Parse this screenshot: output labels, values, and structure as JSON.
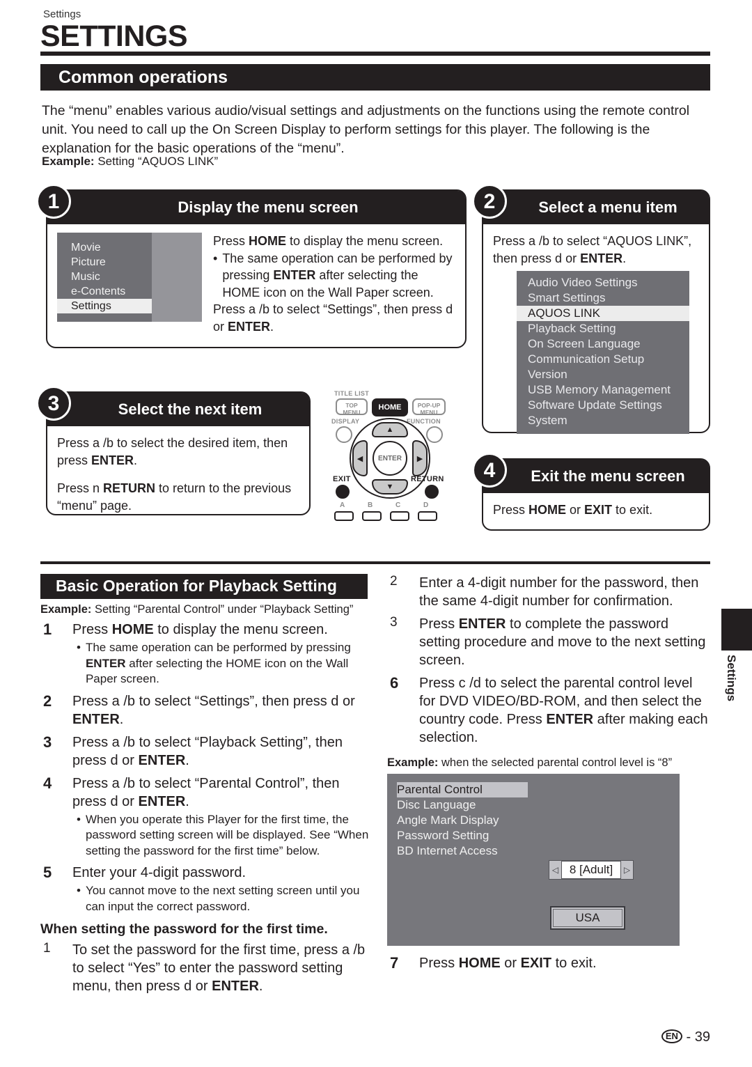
{
  "header": {
    "running_head": "Settings",
    "title": "SETTINGS",
    "section_title": "Common operations"
  },
  "intro": {
    "paragraph": "The “menu” enables various audio/visual settings and adjustments on the functions using the remote control unit. You need to call up the On Screen Display to perform settings for this player. The following is the explanation for the basic operations of the “menu”.",
    "example_label": "Example:",
    "example_text": "Setting “AQUOS LINK”"
  },
  "steps": {
    "one": {
      "number": "1",
      "title": "Display the menu screen",
      "line1_a": "Press ",
      "line1_b": "HOME",
      "line1_c": " to display the menu screen.",
      "bullet_dot": "•",
      "bullet_a": "The same operation can be performed by pressing ",
      "bullet_b": "ENTER",
      "bullet_c": " after selecting the HOME icon on the Wall Paper screen.",
      "line2_a": "Press a /b  to select “Settings”, then press d  or ",
      "line2_b": "ENTER",
      "line2_c": ".",
      "menu_items": [
        "Movie",
        "Picture",
        "Music",
        "e-Contents",
        "Settings"
      ],
      "menu_selected": "Settings"
    },
    "two": {
      "number": "2",
      "title": "Select a menu item",
      "line_a": "Press a /b  to select “AQUOS LINK”, then press d  or ",
      "line_b": "ENTER",
      "line_c": ".",
      "menu_items": [
        "Audio Video Settings",
        "Smart Settings",
        "AQUOS LINK",
        "Playback Setting",
        "On Screen Language",
        "Communication Setup",
        "Version",
        "USB Memory Management",
        "Software Update Settings",
        "System"
      ],
      "menu_selected": "AQUOS LINK"
    },
    "three": {
      "number": "3",
      "title": "Select the next item",
      "p1_a": "Press a /b  to select the desired item, then press ",
      "p1_b": "ENTER",
      "p1_c": ".",
      "p2_a": "Press n    ",
      "p2_b": "RETURN",
      "p2_c": " to return to the previous “menu” page."
    },
    "four": {
      "number": "4",
      "title": "Exit the menu screen",
      "line_a": "Press ",
      "line_b": "HOME",
      "line_c": " or ",
      "line_d": "EXIT",
      "line_e": " to exit."
    }
  },
  "remote": {
    "title_list": "TITLE LIST",
    "top_menu_1": "TOP",
    "top_menu_2": "MENU",
    "home": "HOME",
    "popup_1": "POP-UP",
    "popup_2": "MENU",
    "display": "DISPLAY",
    "function": "FUNCTION",
    "enter": "ENTER",
    "exit": "EXIT",
    "return": "RETURN",
    "up": "▲",
    "down": "▼",
    "left": "◀",
    "right": "▶",
    "color_buttons": [
      "A",
      "B",
      "C",
      "D"
    ]
  },
  "lower": {
    "section_title": "Basic Operation for Playback Setting",
    "example_label": "Example:",
    "example_text": "Setting “Parental Control” under “Playback Setting”",
    "left_steps": [
      {
        "n": "1",
        "text_a": "Press ",
        "text_b": "HOME",
        "text_c": " to display the menu screen.",
        "bullets": [
          {
            "dot": "•",
            "a": "The same operation can be performed by pressing ",
            "b": "ENTER",
            "c": " after selecting the HOME icon on the Wall Paper screen."
          }
        ]
      },
      {
        "n": "2",
        "text_a": "Press a /b  to select “Settings”, then press d  or ",
        "text_b": "ENTER",
        "text_c": ".",
        "bullets": []
      },
      {
        "n": "3",
        "text_a": "Press a /b  to select “Playback Setting”, then press d  or ",
        "text_b": "ENTER",
        "text_c": ".",
        "bullets": []
      },
      {
        "n": "4",
        "text_a": "Press a /b  to select “Parental Control”, then press d  or ",
        "text_b": "ENTER",
        "text_c": ".",
        "bullets": [
          {
            "dot": "•",
            "a": "When you operate this Player for the first time, the password setting screen will be displayed. See “When setting the password for the first time” below.",
            "b": "",
            "c": ""
          }
        ]
      },
      {
        "n": "5",
        "text_a": "Enter your 4-digit password.",
        "text_b": "",
        "text_c": "",
        "bullets": [
          {
            "dot": "•",
            "a": "You cannot move to the next setting screen until you can input the correct password.",
            "b": "",
            "c": ""
          }
        ]
      }
    ],
    "first_time_heading": "When setting the password for the first time.",
    "first_time_step": {
      "n": "1",
      "text_a": "To set the password for the first time, press a /b to select “Yes” to enter the password setting menu, then press d  or ",
      "text_b": "ENTER",
      "text_c": "."
    },
    "right_steps": [
      {
        "n": "2",
        "thin": true,
        "text_a": "Enter a 4-digit number for the password, then the same 4-digit number for confirmation.",
        "text_b": "",
        "text_c": ""
      },
      {
        "n": "3",
        "thin": true,
        "text_a": "Press ",
        "text_b": "ENTER",
        "text_c": " to complete the password setting procedure and move to the next setting screen."
      },
      {
        "n": "6",
        "thin": false,
        "text_a": "Press c /d  to select the parental control level for DVD VIDEO/BD-ROM, and then select the country code. Press ",
        "text_b": "ENTER",
        "text_c": " after making each selection."
      }
    ],
    "pc_example_label": "Example:",
    "pc_example_text": "when the selected parental control level is “8”",
    "parental_screen": {
      "items": [
        "Parental Control",
        "Disc Language",
        "Angle Mark Display",
        "Password Setting",
        "BD Internet Access"
      ],
      "selected": "Parental Control",
      "left_arrow": "◁",
      "right_arrow": "▷",
      "level_value": "8 [Adult]",
      "country_value": "USA"
    },
    "final_step": {
      "n": "7",
      "text_a": "Press ",
      "text_b": "HOME",
      "text_c": " or ",
      "text_d": "EXIT",
      "text_e": " to exit."
    }
  },
  "side_tab": {
    "label": "Settings"
  },
  "footer": {
    "lang_badge": "EN",
    "separator": "-",
    "page_number": "39"
  },
  "colors": {
    "ink": "#231f20",
    "menu_dark": "#6f6f74",
    "menu_light": "#95959a",
    "highlight": "#ececec"
  }
}
